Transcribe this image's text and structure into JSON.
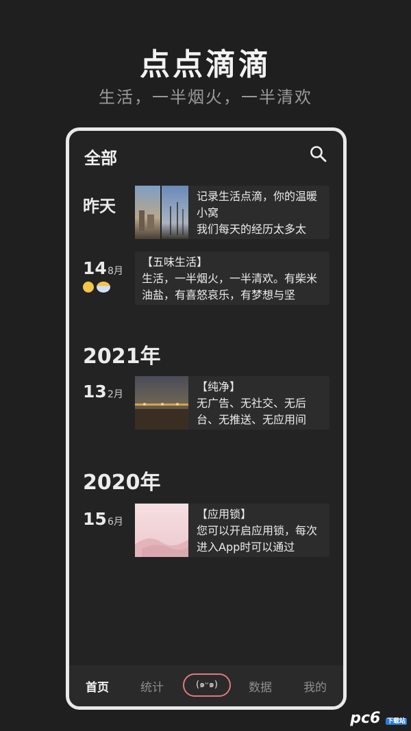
{
  "promo": {
    "title": "点点滴滴",
    "subtitle": "生活，一半烟火，一半清欢"
  },
  "header": {
    "title": "全部",
    "search_icon": "search-icon"
  },
  "entries": [
    {
      "date_label": "昨天",
      "text": "记录生活点滴，你的温暖小窝\n我们每天的经历太多太"
    },
    {
      "day": "14",
      "month": "8月",
      "text": "【五味生活】\n生活，一半烟火，一半清欢。有柴米油盐，有喜怒哀乐，有梦想与坚",
      "mood_icons": [
        "smile-emoji-icon",
        "partly-cloudy-icon"
      ]
    },
    {
      "day": "13",
      "month": "2月",
      "text": "【纯净】\n无广告、无社交、无后台、无推送、无应用间"
    },
    {
      "day": "15",
      "month": "6月",
      "text": "【应用锁】\n您可以开启应用锁，每次进入App时可以通过"
    }
  ],
  "years": [
    "2021年",
    "2020年"
  ],
  "tabbar": {
    "tabs": [
      "首页",
      "统计",
      "数据",
      "我的"
    ],
    "center_label": "(๑ᵕ๑)",
    "active": "首页"
  },
  "watermark": {
    "text": "pc6",
    "badge": "下载站"
  },
  "colors": {
    "background": "#1f1f1f",
    "card": "#2c2c2c",
    "accent": "#e07a7a"
  }
}
